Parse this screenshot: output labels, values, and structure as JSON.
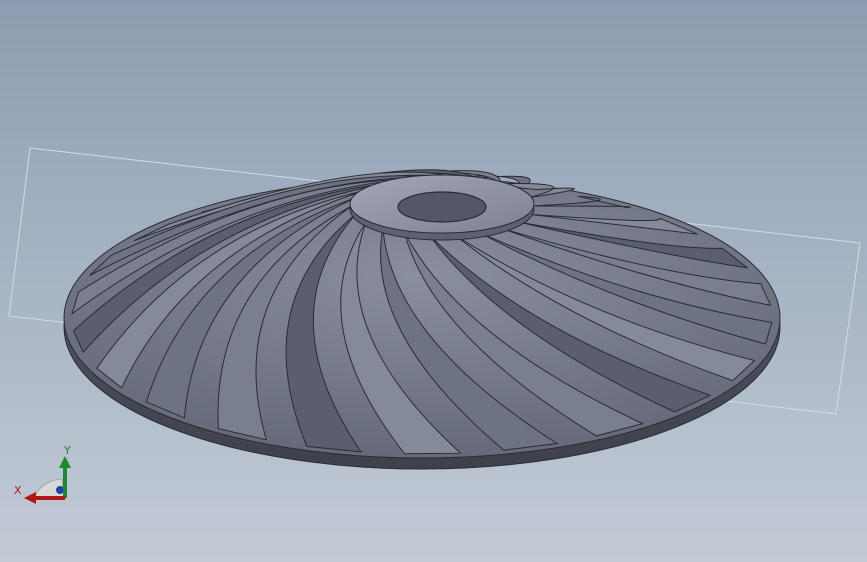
{
  "colors": {
    "background_top": "#8c9db1",
    "background_bottom": "#c3cbd6",
    "part_fill": "#7b8090",
    "part_dark": "#4c5060",
    "part_light": "#9a9fb0",
    "outline": "#2a2c33",
    "plane_outline": "#d5dbe3",
    "axis_x": "#b01818",
    "axis_y": "#1c8a2c",
    "axis_z": "#1e3fae"
  },
  "viewport": {
    "model": "impeller",
    "blade_count": 22,
    "reference_plane_visible": true
  },
  "triad": {
    "x_label": "X",
    "y_label": "Y"
  }
}
